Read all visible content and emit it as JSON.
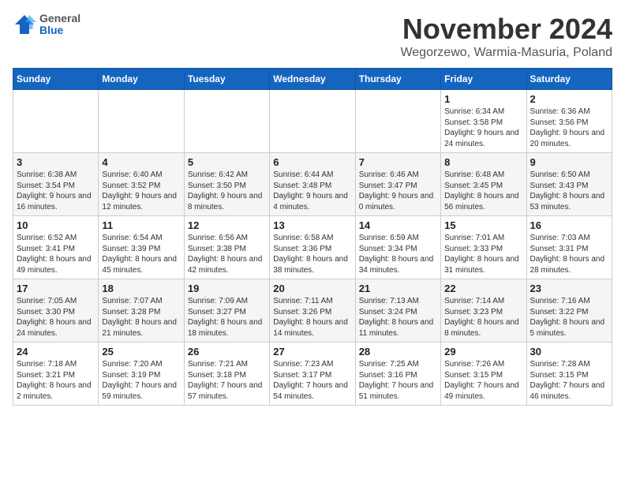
{
  "logo": {
    "general": "General",
    "blue": "Blue"
  },
  "header": {
    "month_year": "November 2024",
    "location": "Wegorzewo, Warmia-Masuria, Poland"
  },
  "weekdays": [
    "Sunday",
    "Monday",
    "Tuesday",
    "Wednesday",
    "Thursday",
    "Friday",
    "Saturday"
  ],
  "weeks": [
    [
      {
        "day": "",
        "info": ""
      },
      {
        "day": "",
        "info": ""
      },
      {
        "day": "",
        "info": ""
      },
      {
        "day": "",
        "info": ""
      },
      {
        "day": "",
        "info": ""
      },
      {
        "day": "1",
        "info": "Sunrise: 6:34 AM\nSunset: 3:58 PM\nDaylight: 9 hours and 24 minutes."
      },
      {
        "day": "2",
        "info": "Sunrise: 6:36 AM\nSunset: 3:56 PM\nDaylight: 9 hours and 20 minutes."
      }
    ],
    [
      {
        "day": "3",
        "info": "Sunrise: 6:38 AM\nSunset: 3:54 PM\nDaylight: 9 hours and 16 minutes."
      },
      {
        "day": "4",
        "info": "Sunrise: 6:40 AM\nSunset: 3:52 PM\nDaylight: 9 hours and 12 minutes."
      },
      {
        "day": "5",
        "info": "Sunrise: 6:42 AM\nSunset: 3:50 PM\nDaylight: 9 hours and 8 minutes."
      },
      {
        "day": "6",
        "info": "Sunrise: 6:44 AM\nSunset: 3:48 PM\nDaylight: 9 hours and 4 minutes."
      },
      {
        "day": "7",
        "info": "Sunrise: 6:46 AM\nSunset: 3:47 PM\nDaylight: 9 hours and 0 minutes."
      },
      {
        "day": "8",
        "info": "Sunrise: 6:48 AM\nSunset: 3:45 PM\nDaylight: 8 hours and 56 minutes."
      },
      {
        "day": "9",
        "info": "Sunrise: 6:50 AM\nSunset: 3:43 PM\nDaylight: 8 hours and 53 minutes."
      }
    ],
    [
      {
        "day": "10",
        "info": "Sunrise: 6:52 AM\nSunset: 3:41 PM\nDaylight: 8 hours and 49 minutes."
      },
      {
        "day": "11",
        "info": "Sunrise: 6:54 AM\nSunset: 3:39 PM\nDaylight: 8 hours and 45 minutes."
      },
      {
        "day": "12",
        "info": "Sunrise: 6:56 AM\nSunset: 3:38 PM\nDaylight: 8 hours and 42 minutes."
      },
      {
        "day": "13",
        "info": "Sunrise: 6:58 AM\nSunset: 3:36 PM\nDaylight: 8 hours and 38 minutes."
      },
      {
        "day": "14",
        "info": "Sunrise: 6:59 AM\nSunset: 3:34 PM\nDaylight: 8 hours and 34 minutes."
      },
      {
        "day": "15",
        "info": "Sunrise: 7:01 AM\nSunset: 3:33 PM\nDaylight: 8 hours and 31 minutes."
      },
      {
        "day": "16",
        "info": "Sunrise: 7:03 AM\nSunset: 3:31 PM\nDaylight: 8 hours and 28 minutes."
      }
    ],
    [
      {
        "day": "17",
        "info": "Sunrise: 7:05 AM\nSunset: 3:30 PM\nDaylight: 8 hours and 24 minutes."
      },
      {
        "day": "18",
        "info": "Sunrise: 7:07 AM\nSunset: 3:28 PM\nDaylight: 8 hours and 21 minutes."
      },
      {
        "day": "19",
        "info": "Sunrise: 7:09 AM\nSunset: 3:27 PM\nDaylight: 8 hours and 18 minutes."
      },
      {
        "day": "20",
        "info": "Sunrise: 7:11 AM\nSunset: 3:26 PM\nDaylight: 8 hours and 14 minutes."
      },
      {
        "day": "21",
        "info": "Sunrise: 7:13 AM\nSunset: 3:24 PM\nDaylight: 8 hours and 11 minutes."
      },
      {
        "day": "22",
        "info": "Sunrise: 7:14 AM\nSunset: 3:23 PM\nDaylight: 8 hours and 8 minutes."
      },
      {
        "day": "23",
        "info": "Sunrise: 7:16 AM\nSunset: 3:22 PM\nDaylight: 8 hours and 5 minutes."
      }
    ],
    [
      {
        "day": "24",
        "info": "Sunrise: 7:18 AM\nSunset: 3:21 PM\nDaylight: 8 hours and 2 minutes."
      },
      {
        "day": "25",
        "info": "Sunrise: 7:20 AM\nSunset: 3:19 PM\nDaylight: 7 hours and 59 minutes."
      },
      {
        "day": "26",
        "info": "Sunrise: 7:21 AM\nSunset: 3:18 PM\nDaylight: 7 hours and 57 minutes."
      },
      {
        "day": "27",
        "info": "Sunrise: 7:23 AM\nSunset: 3:17 PM\nDaylight: 7 hours and 54 minutes."
      },
      {
        "day": "28",
        "info": "Sunrise: 7:25 AM\nSunset: 3:16 PM\nDaylight: 7 hours and 51 minutes."
      },
      {
        "day": "29",
        "info": "Sunrise: 7:26 AM\nSunset: 3:15 PM\nDaylight: 7 hours and 49 minutes."
      },
      {
        "day": "30",
        "info": "Sunrise: 7:28 AM\nSunset: 3:15 PM\nDaylight: 7 hours and 46 minutes."
      }
    ]
  ]
}
